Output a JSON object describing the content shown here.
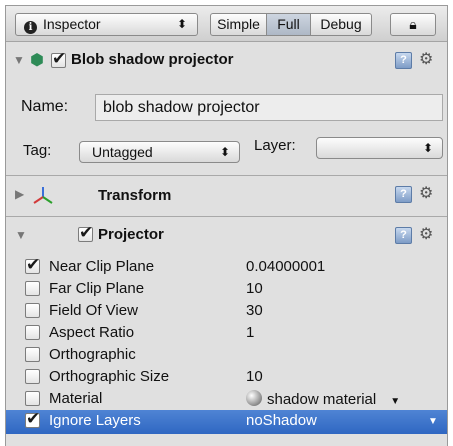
{
  "toolbar": {
    "inspector_label": "Inspector",
    "modes": {
      "simple": "Simple",
      "full": "Full",
      "debug": "Debug"
    },
    "selected_mode": "Full"
  },
  "object": {
    "title": "Blob shadow projector",
    "enabled": true,
    "name_label": "Name:",
    "name_value": "blob shadow projector",
    "tag_label": "Tag:",
    "tag_value": "Untagged",
    "layer_label": "Layer:",
    "layer_value": ""
  },
  "components": {
    "transform": {
      "label": "Transform",
      "expanded": false
    },
    "projector": {
      "label": "Projector",
      "expanded": true,
      "enabled": true
    }
  },
  "properties": [
    {
      "label": "Near Clip Plane",
      "value": "0.04000001",
      "checked": true
    },
    {
      "label": "Far Clip Plane",
      "value": "10",
      "checked": false
    },
    {
      "label": "Field Of View",
      "value": "30",
      "checked": false
    },
    {
      "label": "Aspect Ratio",
      "value": "1",
      "checked": false
    },
    {
      "label": "Orthographic",
      "value": "",
      "checked": false
    },
    {
      "label": "Orthographic Size",
      "value": "10",
      "checked": false
    },
    {
      "label": "Material",
      "value": "shadow material",
      "checked": false
    },
    {
      "label": "Ignore Layers",
      "value": "noShadow",
      "checked": true
    }
  ],
  "colors": {
    "selection": "#2f67c2",
    "panel_bg": "#e0e0e0"
  }
}
